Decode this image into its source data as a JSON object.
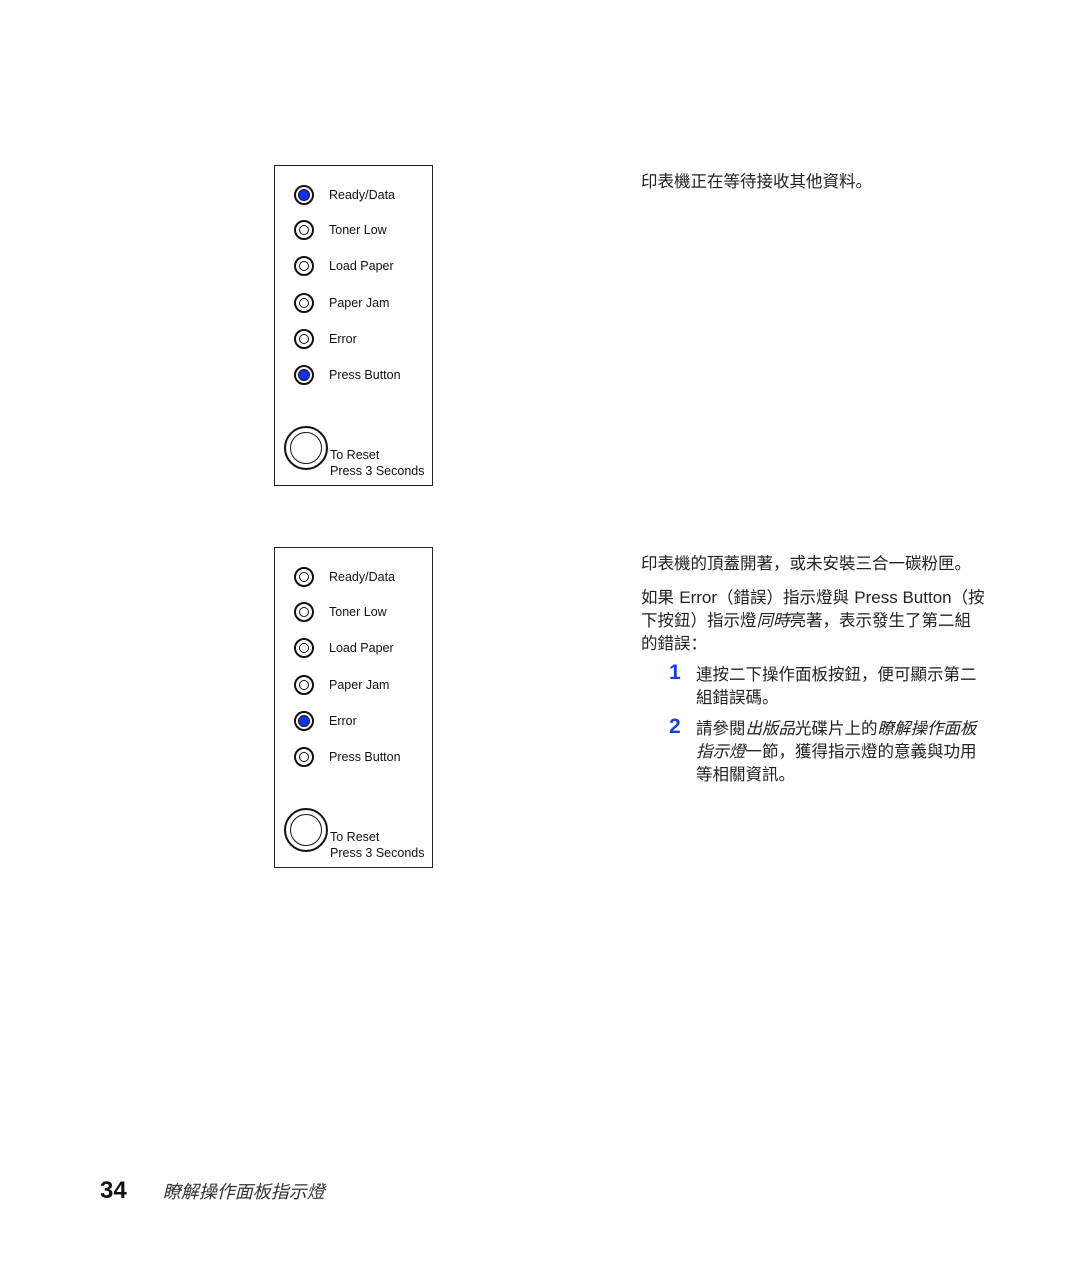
{
  "panels": [
    {
      "leds": [
        {
          "label": "Ready/Data",
          "state": "on"
        },
        {
          "label": "Toner Low",
          "state": "off"
        },
        {
          "label": "Load Paper",
          "state": "off"
        },
        {
          "label": "Paper Jam",
          "state": "off"
        },
        {
          "label": "Error",
          "state": "off"
        },
        {
          "label": "Press Button",
          "state": "on"
        }
      ],
      "reset_line1": "To Reset",
      "reset_line2": "Press 3 Seconds"
    },
    {
      "leds": [
        {
          "label": "Ready/Data",
          "state": "off"
        },
        {
          "label": "Toner Low",
          "state": "off"
        },
        {
          "label": "Load Paper",
          "state": "off"
        },
        {
          "label": "Paper Jam",
          "state": "off"
        },
        {
          "label": "Error",
          "state": "on"
        },
        {
          "label": "Press Button",
          "state": "off"
        }
      ],
      "reset_line1": "To Reset",
      "reset_line2": "Press 3 Seconds"
    }
  ],
  "colors": {
    "led_on": "#1133ee",
    "step_number": "#1a3fd6"
  },
  "desc1": "印表機正在等待接收其他資料。",
  "desc2": {
    "para1": "印表機的頂蓋開著，或未安裝三合一碳粉匣。",
    "para2_a": "如果 ",
    "para2_error": "Error",
    "para2_b": "（錯誤）指示燈與 ",
    "para2_press": "Press Button",
    "para2_c": "（按下按鈕）指示燈",
    "para2_em": "同時",
    "para2_d": "亮著，表示發生了第二組的錯誤：",
    "steps": [
      {
        "num": "1",
        "text": "連按二下操作面板按鈕，便可顯示第二組錯誤碼。"
      },
      {
        "num": "2",
        "text_a": "請參閱",
        "em1": "出版品",
        "text_b": "光碟片上的",
        "em2": "瞭解操作面板指示燈",
        "text_c": "一節，獲得指示燈的意義與功用等相關資訊。"
      }
    ]
  },
  "footer": {
    "page_number": "34",
    "running_title": "瞭解操作面板指示燈"
  }
}
